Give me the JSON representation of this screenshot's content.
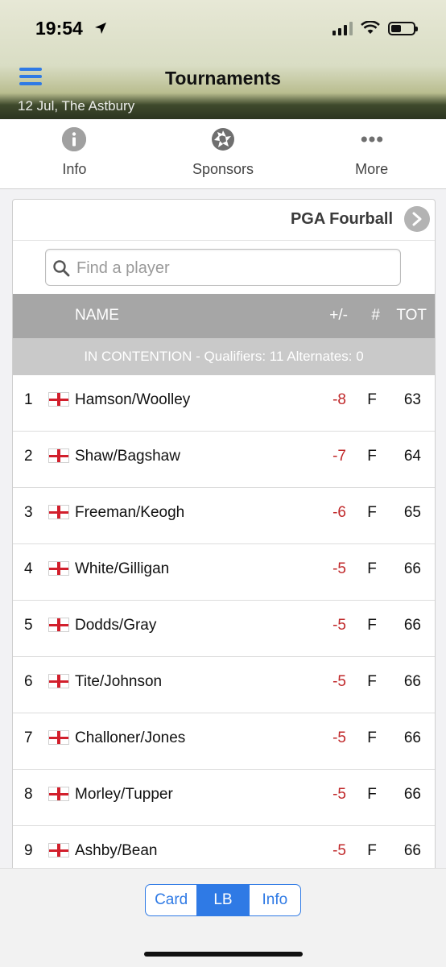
{
  "status_bar": {
    "time": "19:54"
  },
  "header": {
    "title": "Tournaments",
    "subtitle": "12 Jul, The Astbury"
  },
  "tabs": [
    {
      "label": "Info",
      "icon": "info-icon"
    },
    {
      "label": "Sponsors",
      "icon": "aperture-icon"
    },
    {
      "label": "More",
      "icon": "more-dots-icon"
    }
  ],
  "leaderboard": {
    "event_name": "PGA Fourball",
    "search_placeholder": "Find a player",
    "columns": {
      "name": "NAME",
      "score": "+/-",
      "thru": "#",
      "total": "TOT"
    },
    "section_label": "IN CONTENTION - Qualifiers: 11  Alternates: 0",
    "rows": [
      {
        "pos": "1",
        "name": "Hamson/Woolley",
        "score": "-8",
        "thru": "F",
        "total": "63"
      },
      {
        "pos": "2",
        "name": "Shaw/Bagshaw",
        "score": "-7",
        "thru": "F",
        "total": "64"
      },
      {
        "pos": "3",
        "name": "Freeman/Keogh",
        "score": "-6",
        "thru": "F",
        "total": "65"
      },
      {
        "pos": "4",
        "name": "White/Gilligan",
        "score": "-5",
        "thru": "F",
        "total": "66"
      },
      {
        "pos": "5",
        "name": "Dodds/Gray",
        "score": "-5",
        "thru": "F",
        "total": "66"
      },
      {
        "pos": "6",
        "name": "Tite/Johnson",
        "score": "-5",
        "thru": "F",
        "total": "66"
      },
      {
        "pos": "7",
        "name": "Challoner/Jones",
        "score": "-5",
        "thru": "F",
        "total": "66"
      },
      {
        "pos": "8",
        "name": "Morley/Tupper",
        "score": "-5",
        "thru": "F",
        "total": "66"
      },
      {
        "pos": "9",
        "name": "Ashby/Bean",
        "score": "-5",
        "thru": "F",
        "total": "66"
      }
    ]
  },
  "bottom_tabs": {
    "card": "Card",
    "lb": "LB",
    "info": "Info",
    "active": "LB"
  },
  "colors": {
    "accent": "#2f7ae5",
    "negative_score": "#c0282a",
    "header_gray": "#a6a6a6"
  }
}
